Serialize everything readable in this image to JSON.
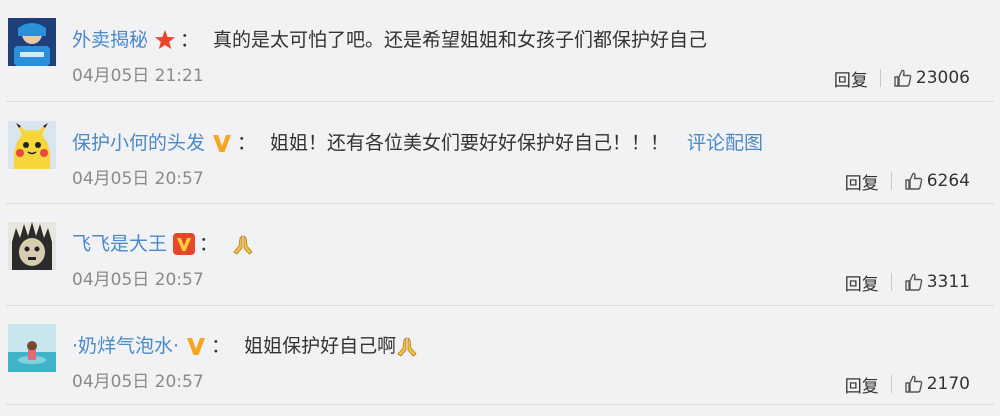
{
  "comments": [
    {
      "username": "外卖揭秘",
      "badge": "red-star",
      "colon": "：",
      "text": "真的是太可怕了吧。还是希望姐姐和女孩子们都保护好自己",
      "time": "04月05日 21:21",
      "reply": "回复",
      "likes": "23006",
      "avatar": "delivery-rider-avatar"
    },
    {
      "username": "保护小何的头发",
      "badge": "gold-v",
      "colon": "：",
      "text": "姐姐！还有各位美女们要好好保护好自己！！！",
      "link": "评论配图",
      "time": "04月05日 20:57",
      "reply": "回复",
      "likes": "6264",
      "avatar": "pikachu-avatar"
    },
    {
      "username": "飞飞是大王",
      "badge": "red-v",
      "colon": "：",
      "text": "",
      "emoji": "praying-hands-icon",
      "time": "04月05日 20:57",
      "reply": "回复",
      "likes": "3311",
      "avatar": "cartoon-avatar"
    },
    {
      "username": "·奶烊气泡水·",
      "badge": "gold-v",
      "colon": "：",
      "text": "姐姐保护好自己啊",
      "emoji": "praying-hands-icon",
      "time": "04月05日 20:57",
      "reply": "回复",
      "likes": "2170",
      "avatar": "beach-photo-avatar"
    }
  ],
  "colors": {
    "link": "#4a8ac9",
    "text": "#333333",
    "meta": "#8a8a8a",
    "background": "#f2f2f5",
    "badge_gold": "#f5a623",
    "badge_red": "#e8472b"
  }
}
